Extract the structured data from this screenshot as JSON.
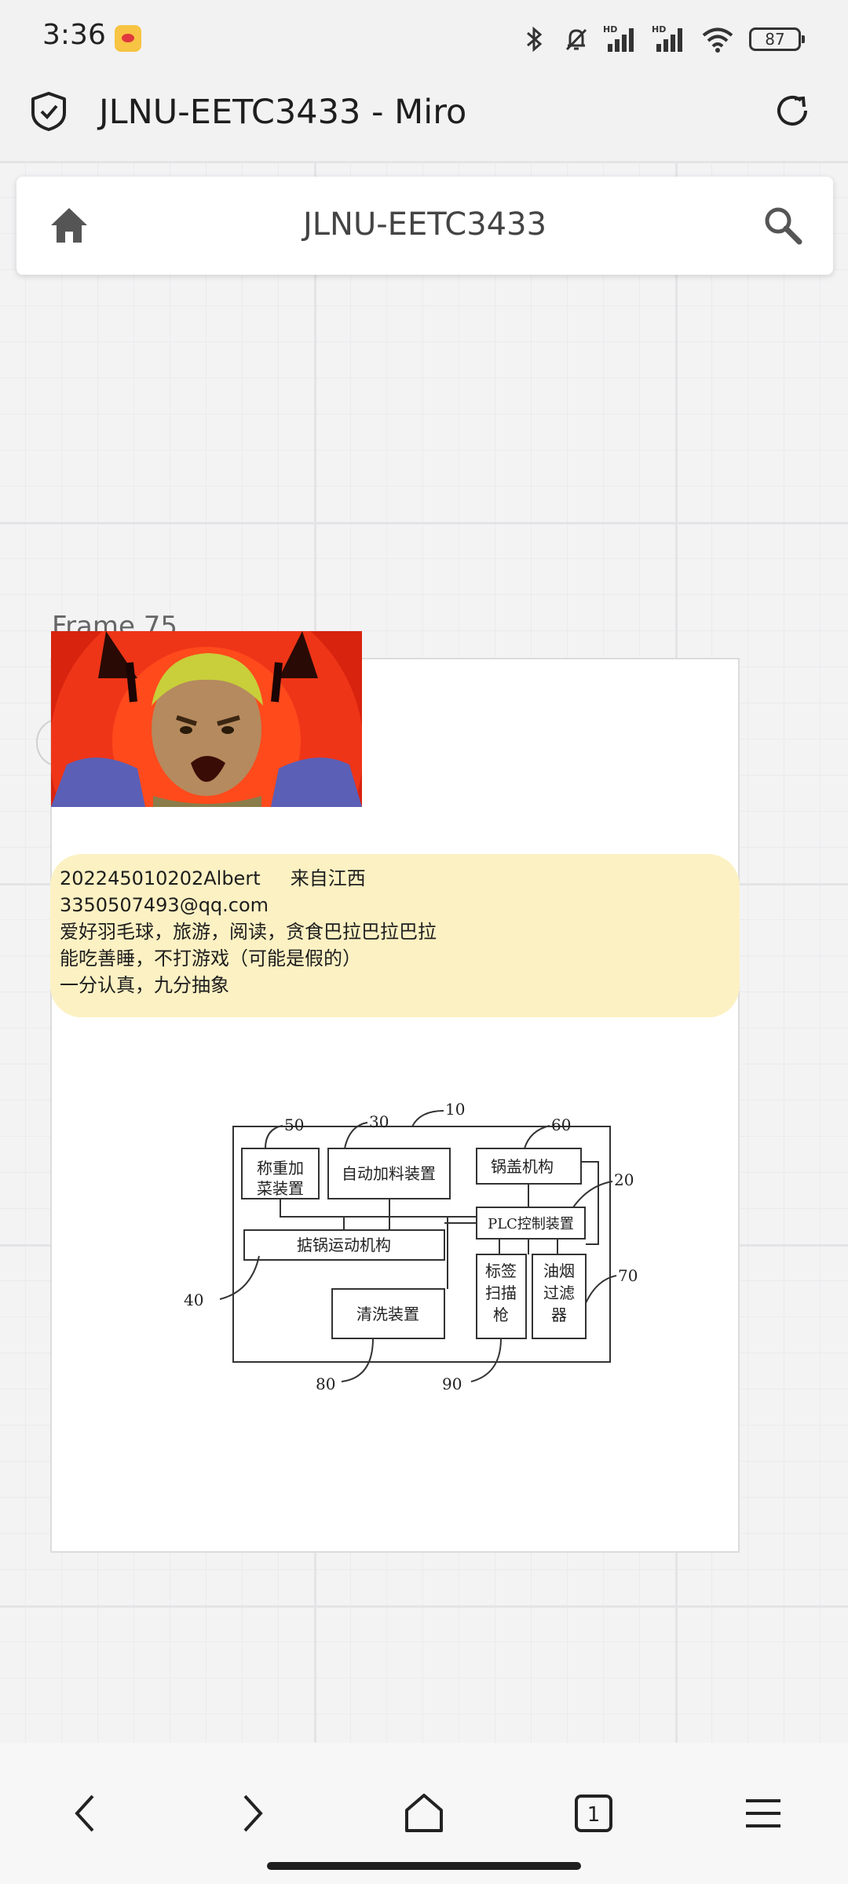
{
  "status": {
    "time": "3:36",
    "battery": "87"
  },
  "browser": {
    "title": "JLNU-EETC3433 - Miro"
  },
  "board": {
    "title": "JLNU-EETC3433",
    "frame_label": "Frame 75"
  },
  "sticky": {
    "lines": [
      "202245010202Albert     来自江西",
      "3350507493@qq.com",
      "爱好羽毛球，旅游，阅读，贪食巴拉巴拉巴拉",
      "能吃善睡，不打游戏（可能是假的）",
      "一分认真，九分抽象"
    ]
  },
  "diagram": {
    "boxes": {
      "weigh": [
        "称重加",
        "菜装置"
      ],
      "auto_feed": "自动加料装置",
      "lid": "锅盖机构",
      "plc": "PLC控制装置",
      "pot_motion": "掂锅运动机构",
      "clean": "清洗装置",
      "scanner": [
        "标签",
        "扫描",
        "枪"
      ],
      "filter": [
        "油烟",
        "过滤",
        "器"
      ]
    },
    "refs": [
      "50",
      "30",
      "10",
      "60",
      "20",
      "70",
      "40",
      "80",
      "90"
    ]
  },
  "nav": {
    "tab_count": "1"
  },
  "colors": {
    "sticky": "#fcf1c3",
    "board_bg": "#f3f3f4",
    "meme_bg": "#e22a10"
  }
}
